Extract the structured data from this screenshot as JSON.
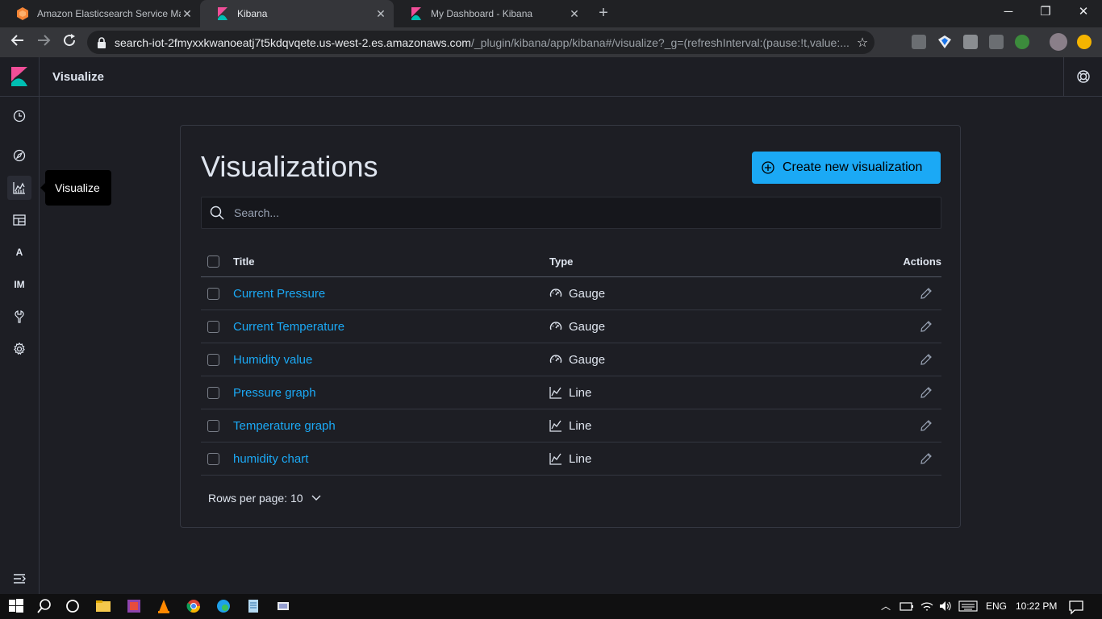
{
  "browser": {
    "tabs": [
      {
        "title": "Amazon Elasticsearch Service Ma",
        "active": false
      },
      {
        "title": "Kibana",
        "active": true
      },
      {
        "title": "My Dashboard - Kibana",
        "active": false
      }
    ],
    "url_host": "search-iot-2fmyxxkwanoeatj7t5kdqvqete.us-west-2.es.amazonaws.com",
    "url_path": "/_plugin/kibana/app/kibana#/visualize?_g=(refreshInterval:(pause:!t,value:..."
  },
  "header": {
    "app_title": "Visualize"
  },
  "sidenav": {
    "items": [
      {
        "name": "recent",
        "icon": "clock-icon"
      },
      {
        "name": "discover",
        "icon": "compass-icon"
      },
      {
        "name": "visualize",
        "icon": "chart-icon"
      },
      {
        "name": "dashboard",
        "icon": "dashboard-icon"
      },
      {
        "name": "alerting",
        "label": "A"
      },
      {
        "name": "index-management",
        "label": "IM"
      },
      {
        "name": "dev-tools",
        "icon": "wrench-icon"
      },
      {
        "name": "management",
        "icon": "gear-icon"
      }
    ],
    "tooltip": "Visualize"
  },
  "main": {
    "title": "Visualizations",
    "create_button": "Create new visualization",
    "search_placeholder": "Search...",
    "columns": {
      "title": "Title",
      "type": "Type",
      "actions": "Actions"
    },
    "rows": [
      {
        "title": "Current Pressure",
        "type": "Gauge"
      },
      {
        "title": "Current Temperature",
        "type": "Gauge"
      },
      {
        "title": "Humidity value",
        "type": "Gauge"
      },
      {
        "title": "Pressure graph",
        "type": "Line"
      },
      {
        "title": "Temperature graph",
        "type": "Line"
      },
      {
        "title": "humidity chart",
        "type": "Line"
      }
    ],
    "rows_per_page": "Rows per page: 10"
  },
  "taskbar": {
    "lang": "ENG",
    "time": "10:22 PM"
  },
  "colors": {
    "accent": "#1ba9f5",
    "background": "#1d1e24",
    "kibana_pink": "#f04e98",
    "kibana_teal": "#00bfb3"
  }
}
